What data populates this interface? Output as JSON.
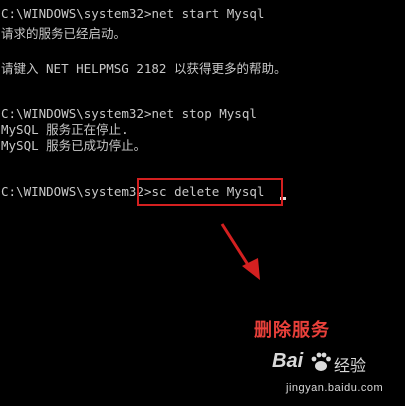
{
  "console": {
    "lines": [
      "C:\\WINDOWS\\system32>net start Mysql",
      "请求的服务已经启动。",
      "",
      "请键入 NET HELPMSG 2182 以获得更多的帮助。",
      "",
      "",
      "C:\\WINDOWS\\system32>net stop Mysql",
      "MySQL 服务正在停止.",
      "MySQL 服务已成功停止。",
      "",
      "",
      "C:\\WINDOWS\\system32>sc delete Mysql"
    ]
  },
  "annotation": {
    "label": "删除服务",
    "color": "#e8403a"
  },
  "colors": {
    "background": "#000000",
    "text": "#c8c8c8",
    "highlight_border": "#d42020"
  },
  "watermark": {
    "brand": "Bai",
    "brand_suffix": "经验",
    "url": "jingyan.baidu.com"
  }
}
